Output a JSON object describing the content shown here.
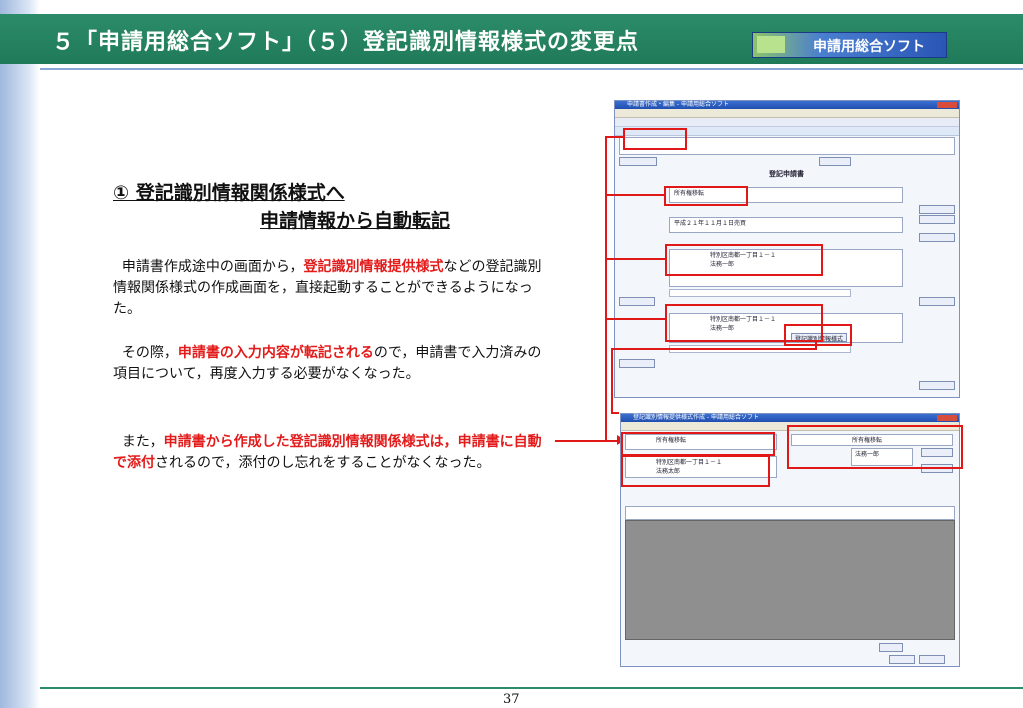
{
  "slide": {
    "title": "５「申請用総合ソフト」（５）登記識別情報様式の変更点",
    "logo_text": "申請用総合ソフト",
    "page_number": "37"
  },
  "content": {
    "heading_line1": "①  登記識別情報関係様式へ",
    "heading_line2": "申請情報から自動転記",
    "p1_a": "申請書作成途中の画面から，",
    "p1_red": "登記識別情報提供様式",
    "p1_b": "などの登記識別情報関係様式の作成画面を，直接起動することができるようになった。",
    "p2_a": "その際，",
    "p2_red": "申請書の入力内容が転記される",
    "p2_b": "ので，申請書で入力済みの項目について，再度入力する必要がなくなった。",
    "p3_a": "また，",
    "p3_red1": "申請書から作成した登記識別情報関係様式は，",
    "p3_red2": "申請書に自動で添付",
    "p3_b": "されるので，添付のし忘れをすることがなくなった。"
  },
  "screenshot_top": {
    "window_title": "申請書作成・編集 - 申請用総合ソフト",
    "doc_title": "登記申請書",
    "field_purpose": "所有権移転",
    "field_cause": "平成２１年１１月１日売買",
    "field_addr": "特別区南都一丁目１－１",
    "field_name": "法務一郎",
    "btn_label": "登記識別情報様式"
  },
  "screenshot_bottom": {
    "window_title": "登記識別情報提供様式作成 - 申請用総合ソフト",
    "field_purpose": "所有権移転",
    "field_addr": "特別区南都一丁目１－１",
    "field_name": "法務太郎",
    "field_name2": "法務一郎"
  },
  "colors": {
    "title_bg": "#2c8c6a",
    "highlight_red": "#e01818",
    "text_red": "#e31b1b"
  }
}
